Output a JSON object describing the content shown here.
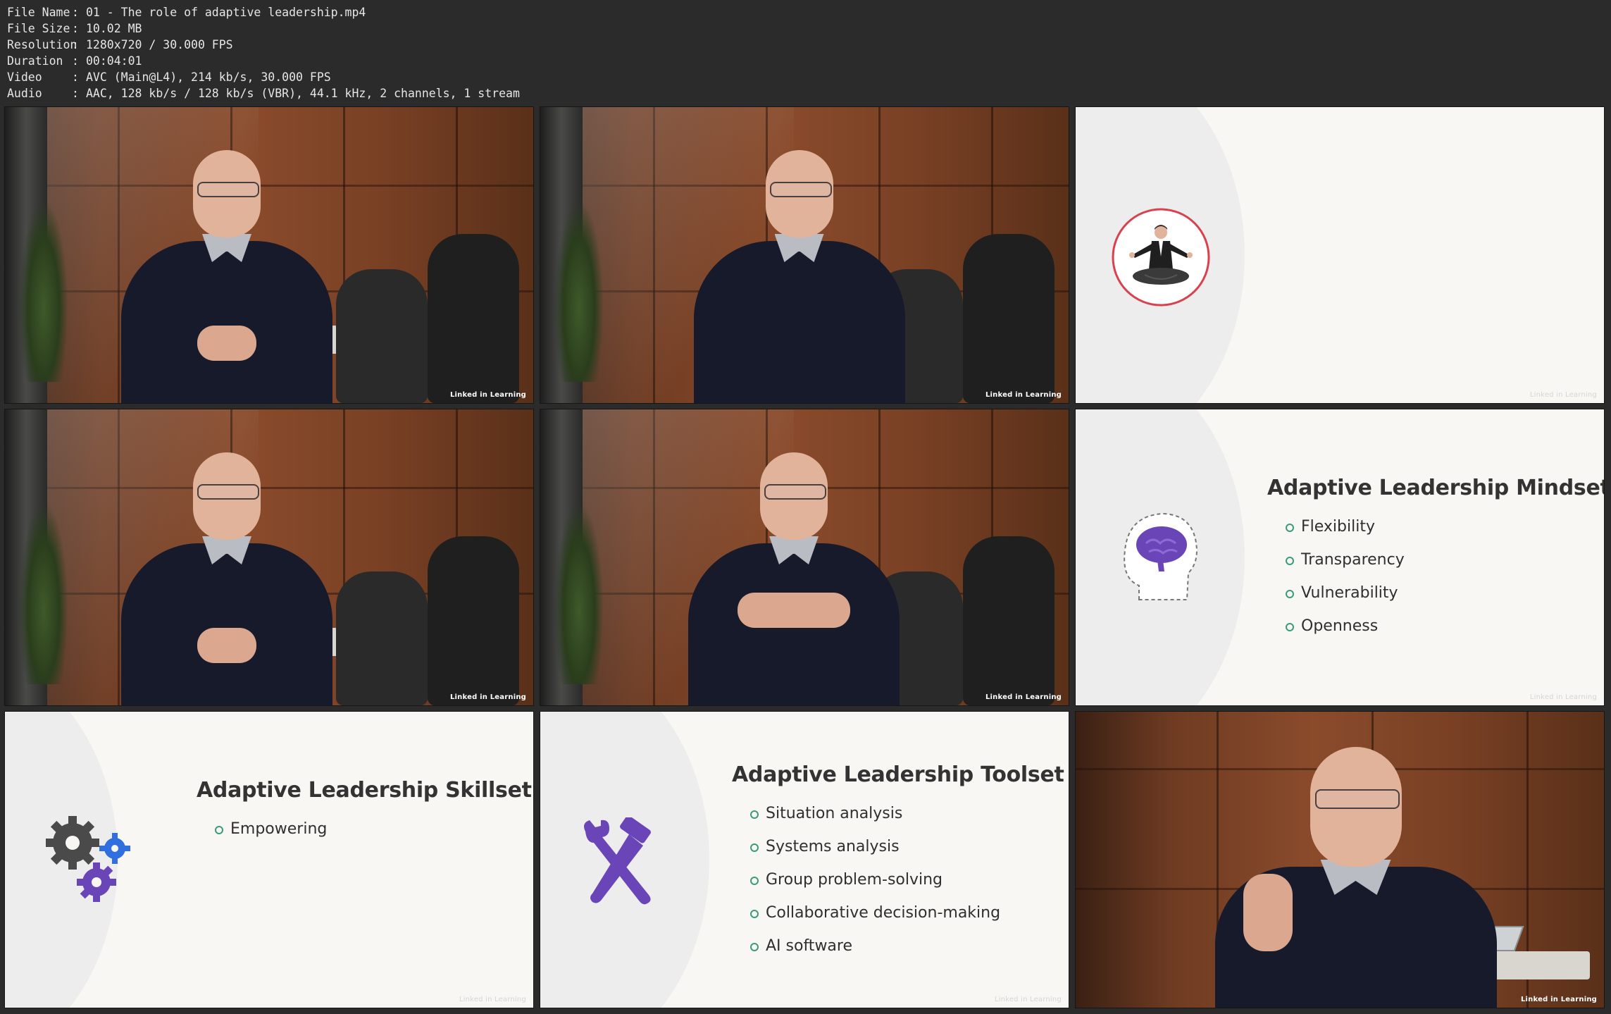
{
  "media_info": {
    "rows": [
      {
        "key": "File Name",
        "value": "01 - The role of adaptive leadership.mp4"
      },
      {
        "key": "File Size",
        "value": "10.02 MB"
      },
      {
        "key": "Resolution",
        "value": "1280x720 / 30.000 FPS"
      },
      {
        "key": "Duration",
        "value": "00:04:01"
      },
      {
        "key": "Video",
        "value": "AVC (Main@L4), 214 kb/s, 30.000 FPS"
      },
      {
        "key": "Audio",
        "value": "AAC, 128 kb/s / 128 kb/s (VBR), 44.1 kHz, 2 channels, 1 stream"
      }
    ]
  },
  "watermark": "Linked in Learning",
  "slides": {
    "mindset": {
      "title": "Adaptive Leadership Mindset",
      "bullets": [
        "Flexibility",
        "Transparency",
        "Vulnerability",
        "Openness"
      ]
    },
    "skillset": {
      "title": "Adaptive Leadership Skillset",
      "bullets": [
        "Empowering"
      ]
    },
    "toolset": {
      "title": "Adaptive Leadership Toolset",
      "bullets": [
        "Situation analysis",
        "Systems analysis",
        "Group problem-solving",
        "Collaborative decision-making",
        "AI software"
      ]
    }
  },
  "icons": {
    "meditation": "meditation-icon",
    "brain": "brain-head-icon",
    "gears": "gears-icon",
    "tools": "wrench-hammer-icon"
  },
  "colors": {
    "accent_bullet": "#3a9b7a",
    "icon_purple": "#6a45b8",
    "icon_blue": "#2f6fe0",
    "icon_gray": "#4a4a4a",
    "circle_red": "#d9414e"
  }
}
